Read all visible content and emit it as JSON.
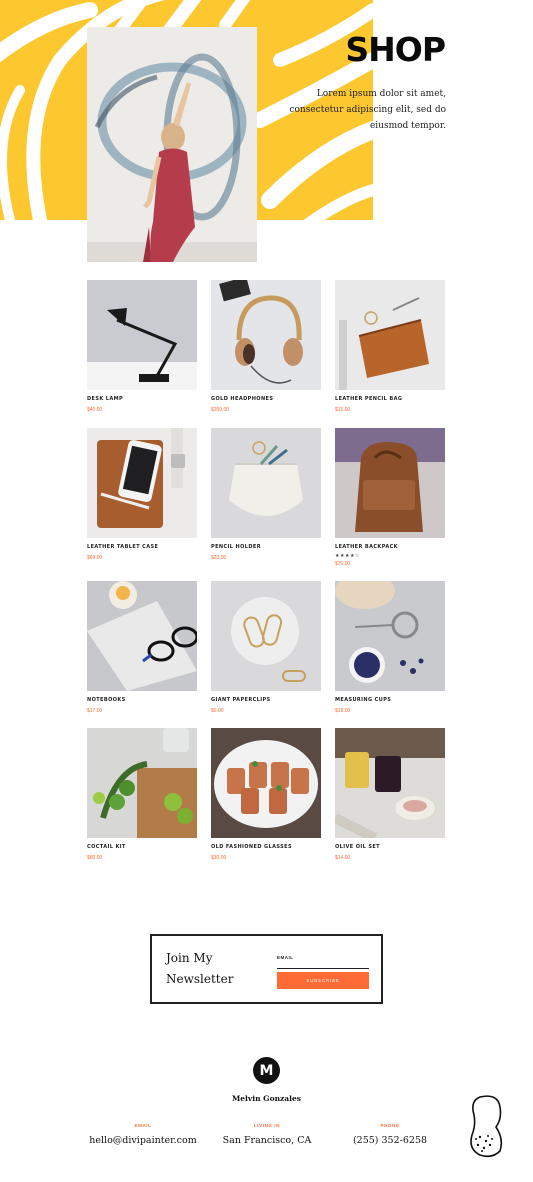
{
  "hero": {
    "title": "SHOP",
    "description": "Lorem ipsum dolor sit amet, consectetur adipiscing elit, sed do eiusmod tempor.",
    "accent_color": "#fcc72f"
  },
  "products": [
    {
      "name": "DESK LAMP",
      "price": "$40.00"
    },
    {
      "name": "GOLD HEADPHONES",
      "price": "$200.00"
    },
    {
      "name": "LEATHER PENCIL BAG",
      "price": "$15.00"
    },
    {
      "name": "LEATHER TABLET CASE",
      "price": "$69.00"
    },
    {
      "name": "PENCIL HOLDER",
      "price": "$20.00"
    },
    {
      "name": "LEATHER BACKPACK",
      "price": "$70.00",
      "rating": "★★★★☆",
      "rating_value": 4
    },
    {
      "name": "NOTEBOOKS",
      "price": "$17.00"
    },
    {
      "name": "GIANT PAPERCLIPS",
      "price": "$6.00"
    },
    {
      "name": "MEASURING CUPS",
      "price": "$18.00"
    },
    {
      "name": "COCTAIL KIT",
      "price": "$60.00"
    },
    {
      "name": "OLD FASHIONED GLASSES",
      "price": "$30.00"
    },
    {
      "name": "OLIVE OIL SET",
      "price": "$14.00"
    }
  ],
  "newsletter": {
    "title": "Join My Newsletter",
    "email_label": "EMAIL",
    "email_value": "",
    "button_label": "SUBSCRIBE",
    "button_color": "#ff6b35"
  },
  "footer": {
    "logo_letter": "M",
    "name": "Melvin Gonzales",
    "contacts": [
      {
        "label": "EMAIL",
        "value": "hello@divipainter.com"
      },
      {
        "label": "LIVING IN",
        "value": "San Francisco, CA"
      },
      {
        "label": "PHONE",
        "value": "(255) 352-6258"
      }
    ],
    "accent_color": "#ff6b35"
  }
}
